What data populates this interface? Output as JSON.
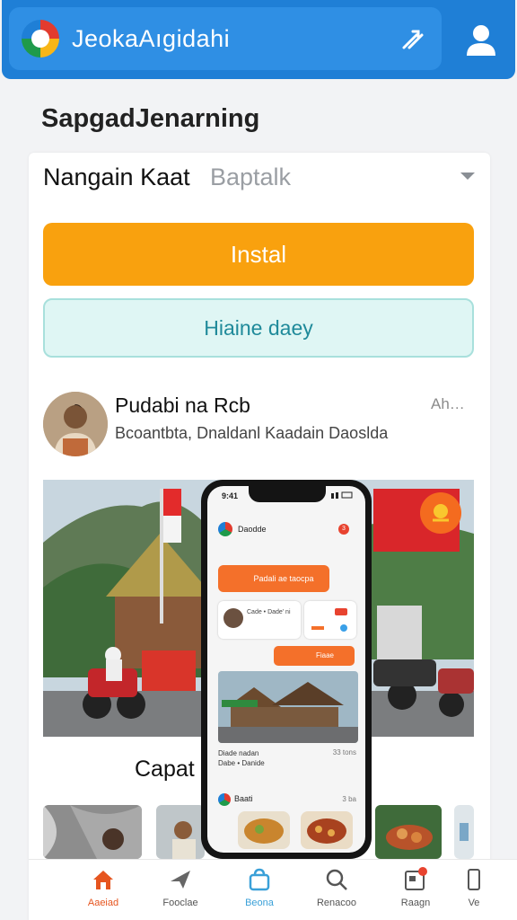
{
  "appbar": {
    "title": "JeokaAıgidahi",
    "tools_icon": "tools-icon",
    "profile_icon": "person-icon"
  },
  "section": {
    "heading": "SapgadJenarning"
  },
  "selector": {
    "value": "Nangain Kaat",
    "hint": "Baptalk",
    "icon": "chevron-down-icon"
  },
  "buttons": {
    "install": "Instal",
    "secondary": "Hiaine daey"
  },
  "post": {
    "author": "Pudabi na Rcb",
    "subtitle": "Bcoantbta, Dnaldanl Kaadain Daoslda",
    "time": "Ah…"
  },
  "caption": "Capat",
  "phone": {
    "time": "9:41",
    "header_title": "Daodde",
    "header_badge": "3",
    "orange_button": "Padali ae taocpa",
    "card_text": "Cade • Dade’ ni",
    "chip": "Fiaae",
    "meta_left": "Diade nadan",
    "meta_sub": "Dabe • Danide",
    "meta_right": "33 tons",
    "footer_title": "Baati",
    "footer_right": "3 ba"
  },
  "bottom_nav": [
    {
      "label": "Aaeiad",
      "icon": "home-icon",
      "active": true
    },
    {
      "label": "Fooclae",
      "icon": "plane-icon",
      "active": false
    },
    {
      "label": "Beona",
      "icon": "bag-icon",
      "active": false
    },
    {
      "label": "Renacoo",
      "icon": "search-icon",
      "active": false
    },
    {
      "label": "Raagn",
      "icon": "news-icon",
      "active": false
    },
    {
      "label": "Ve",
      "icon": "phone-icon",
      "active": false
    }
  ],
  "colors": {
    "appbar": "#1f7fd6",
    "install": "#f9a10e",
    "secondary_bg": "#dff6f4",
    "secondary_text": "#1f8a9a",
    "accent": "#e6551f"
  }
}
